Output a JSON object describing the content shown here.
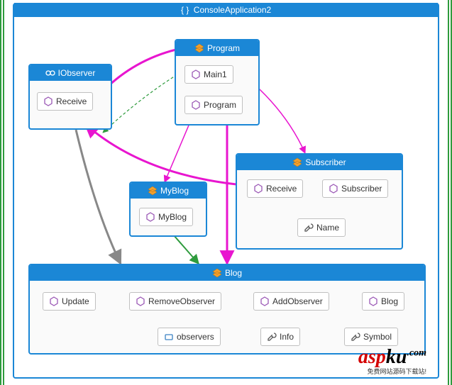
{
  "namespace": {
    "name": "ConsoleApplication2"
  },
  "classes": {
    "iobserver": {
      "name": "IObserver",
      "members": {
        "receive": "Receive"
      }
    },
    "program": {
      "name": "Program",
      "members": {
        "main1": "Main1",
        "program": "Program"
      }
    },
    "myblog": {
      "name": "MyBlog",
      "members": {
        "myblog": "MyBlog"
      }
    },
    "subscriber": {
      "name": "Subscriber",
      "members": {
        "receive": "Receive",
        "subscriber": "Subscriber",
        "name": "Name"
      }
    },
    "blog": {
      "name": "Blog",
      "members": {
        "update": "Update",
        "removeObserver": "RemoveObserver",
        "addObserver": "AddObserver",
        "blog": "Blog",
        "observers": "observers",
        "info": "Info",
        "symbol": "Symbol"
      }
    }
  },
  "watermark": {
    "part1": "asp",
    "part2": "ku",
    "domain": ".com",
    "subtitle": "免费网站源码下载站!"
  },
  "chart_data": {
    "type": "diagram",
    "title": "ConsoleApplication2",
    "nodes": [
      {
        "id": "IObserver",
        "kind": "interface",
        "members": [
          {
            "name": "Receive",
            "kind": "method"
          }
        ]
      },
      {
        "id": "Program",
        "kind": "class",
        "members": [
          {
            "name": "Main1",
            "kind": "method"
          },
          {
            "name": "Program",
            "kind": "method"
          }
        ]
      },
      {
        "id": "MyBlog",
        "kind": "class",
        "members": [
          {
            "name": "MyBlog",
            "kind": "method"
          }
        ]
      },
      {
        "id": "Subscriber",
        "kind": "class",
        "members": [
          {
            "name": "Receive",
            "kind": "method"
          },
          {
            "name": "Subscriber",
            "kind": "method"
          },
          {
            "name": "Name",
            "kind": "property"
          }
        ]
      },
      {
        "id": "Blog",
        "kind": "class",
        "members": [
          {
            "name": "Update",
            "kind": "method"
          },
          {
            "name": "RemoveObserver",
            "kind": "method"
          },
          {
            "name": "AddObserver",
            "kind": "method"
          },
          {
            "name": "Blog",
            "kind": "method"
          },
          {
            "name": "observers",
            "kind": "field"
          },
          {
            "name": "Info",
            "kind": "property"
          },
          {
            "name": "Symbol",
            "kind": "property"
          }
        ]
      }
    ],
    "edges": [
      {
        "from": "Program.Main1",
        "to": "MyBlog",
        "style": "solid",
        "color": "magenta"
      },
      {
        "from": "Program.Main1",
        "to": "Subscriber",
        "style": "solid",
        "color": "magenta"
      },
      {
        "from": "Program.Main1",
        "to": "IObserver",
        "style": "dashed",
        "color": "green"
      },
      {
        "from": "Program",
        "to": "IObserver",
        "style": "solid",
        "color": "magenta"
      },
      {
        "from": "Program",
        "to": "Blog",
        "style": "solid",
        "color": "magenta"
      },
      {
        "from": "IObserver",
        "to": "Blog",
        "style": "solid",
        "color": "gray"
      },
      {
        "from": "MyBlog",
        "to": "Blog",
        "style": "solid",
        "color": "green"
      },
      {
        "from": "Subscriber.Receive",
        "to": "Subscriber.Name",
        "style": "solid",
        "color": "magenta"
      },
      {
        "from": "Subscriber.Subscriber",
        "to": "Subscriber.Name",
        "style": "solid",
        "color": "magenta"
      },
      {
        "from": "Subscriber",
        "to": "IObserver",
        "style": "solid",
        "color": "magenta"
      },
      {
        "from": "Blog.Update",
        "to": "Blog.observers",
        "style": "dashed",
        "color": "blue"
      },
      {
        "from": "Blog.RemoveObserver",
        "to": "Blog.observers",
        "style": "dashed",
        "color": "blue"
      },
      {
        "from": "Blog.AddObserver",
        "to": "Blog.observers",
        "style": "solid",
        "color": "blue"
      },
      {
        "from": "Blog.Blog",
        "to": "Blog.observers",
        "style": "solid",
        "color": "magenta"
      },
      {
        "from": "Blog.Blog",
        "to": "Blog.Info",
        "style": "solid",
        "color": "magenta"
      },
      {
        "from": "Blog.Blog",
        "to": "Blog.Symbol",
        "style": "solid",
        "color": "magenta"
      }
    ]
  }
}
